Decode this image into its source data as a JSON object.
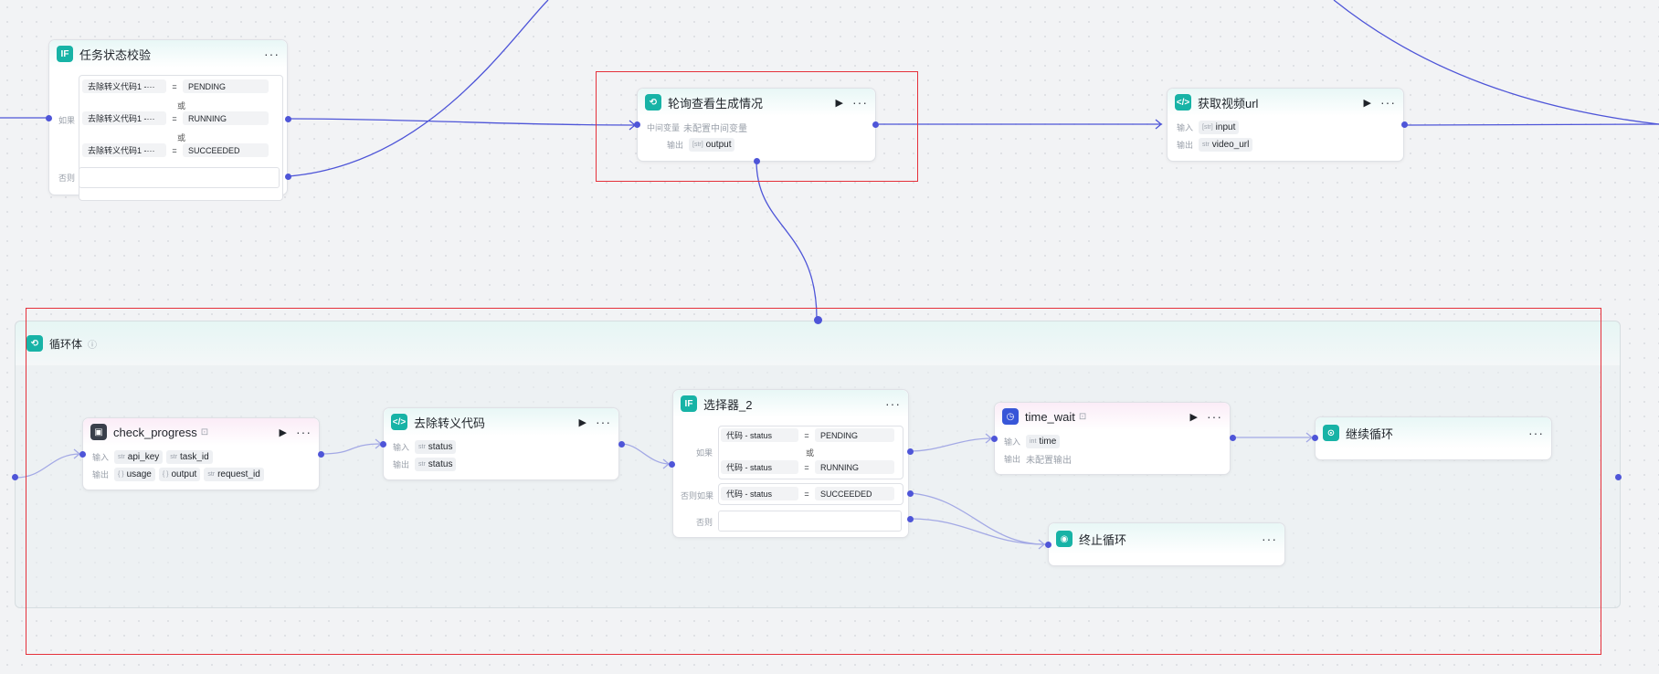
{
  "colors": {
    "wire": "#4e55d8",
    "highlight": "#e5303a",
    "teal": "#17b3a6"
  },
  "nodes": {
    "status_check": {
      "icon": "if-icon",
      "title": "任务状态校验",
      "more": "···",
      "if_label": "如果",
      "else_label": "否则",
      "or": "或",
      "conditions": [
        {
          "left": "去除转义代码1 -···",
          "op": "=",
          "right": "PENDING"
        },
        {
          "left": "去除转义代码1 -···",
          "op": "=",
          "right": "RUNNING"
        },
        {
          "left": "去除转义代码1 -···",
          "op": "=",
          "right": "SUCCEEDED"
        }
      ]
    },
    "poll": {
      "icon": "loop-icon",
      "title": "轮询查看生成情况",
      "run": "▶",
      "more": "···",
      "mid_label": "中间变量",
      "mid_value": "未配置中间变量",
      "output_label": "输出",
      "output_type": "[str]",
      "output_name": "output"
    },
    "get_url": {
      "icon": "code-icon",
      "title": "获取视频url",
      "run": "▶",
      "more": "···",
      "input_label": "输入",
      "input_type": "[str]",
      "input_name": "input",
      "output_label": "输出",
      "output_type": "str",
      "output_name": "video_url"
    },
    "loop_body": {
      "icon": "loop-icon",
      "title": "循环体",
      "info": "ⓘ"
    },
    "check_progress": {
      "icon": "plugin-icon",
      "title": "check_progress",
      "tag_icon": "⊡",
      "run": "▶",
      "more": "···",
      "input_label": "输入",
      "inputs": [
        {
          "type": "str",
          "name": "api_key"
        },
        {
          "type": "str",
          "name": "task_id"
        }
      ],
      "output_label": "输出",
      "outputs": [
        {
          "type": "{ }",
          "name": "usage"
        },
        {
          "type": "{ }",
          "name": "output"
        },
        {
          "type": "str",
          "name": "request_id"
        }
      ]
    },
    "strip_code": {
      "icon": "code-icon",
      "title": "去除转义代码",
      "run": "▶",
      "more": "···",
      "input_label": "输入",
      "input_type": "str",
      "input_name": "status",
      "output_label": "输出",
      "output_type": "str",
      "output_name": "status"
    },
    "selector2": {
      "icon": "if-icon",
      "title": "选择器_2",
      "more": "···",
      "if_label": "如果",
      "elseif_label": "否则如果",
      "else_label": "否则",
      "or": "或",
      "conditions": [
        {
          "left": "代码 - status",
          "op": "=",
          "right": "PENDING"
        },
        {
          "left": "代码 - status",
          "op": "=",
          "right": "RUNNING"
        },
        {
          "left": "代码 - status",
          "op": "=",
          "right": "SUCCEEDED"
        }
      ]
    },
    "time_wait": {
      "icon": "plugin-icon",
      "title": "time_wait",
      "tag_icon": "⊡",
      "run": "▶",
      "more": "···",
      "input_label": "输入",
      "input_type": "int",
      "input_name": "time",
      "output_label": "输出",
      "output_value": "未配置输出"
    },
    "continue_loop": {
      "icon": "continue-icon",
      "title": "继续循环",
      "more": "···"
    },
    "stop_loop": {
      "icon": "stop-icon",
      "title": "终止循环",
      "more": "···"
    }
  }
}
